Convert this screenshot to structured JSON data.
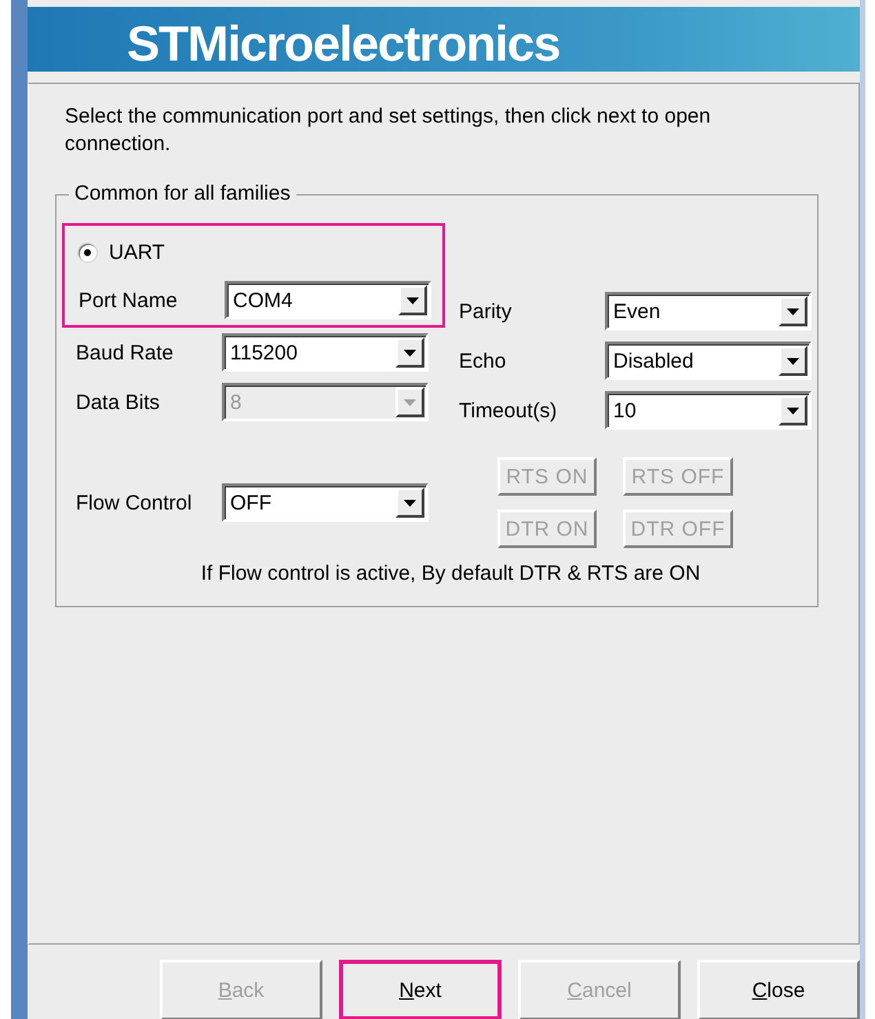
{
  "banner": {
    "title": "STMicroelectronics"
  },
  "instruction": "Select the communication port and set settings, then click next to open connection.",
  "group": {
    "title": "Common for all families",
    "interface": {
      "label": "UART",
      "selected": true,
      "highlighted": true
    },
    "left_fields": [
      {
        "label": "Port Name",
        "value": "COM4",
        "disabled": false
      },
      {
        "label": "Baud Rate",
        "value": "115200",
        "disabled": false
      },
      {
        "label": "Data Bits",
        "value": "8",
        "disabled": true
      }
    ],
    "right_fields": [
      {
        "label": "Parity",
        "value": "Even",
        "disabled": false
      },
      {
        "label": "Echo",
        "value": "Disabled",
        "disabled": false
      },
      {
        "label": "Timeout(s)",
        "value": "10",
        "disabled": false
      }
    ],
    "flow_control": {
      "label": "Flow Control",
      "value": "OFF",
      "disabled": false
    },
    "line_buttons": [
      {
        "label": "RTS ON",
        "disabled": true
      },
      {
        "label": "RTS OFF",
        "disabled": true
      },
      {
        "label": "DTR ON",
        "disabled": true
      },
      {
        "label": "DTR OFF",
        "disabled": true
      }
    ],
    "note": "If Flow control is active, By default DTR & RTS are ON"
  },
  "buttons": [
    {
      "label": "Back",
      "disabled": true,
      "highlighted": false
    },
    {
      "label": "Next",
      "disabled": false,
      "highlighted": true
    },
    {
      "label": "Cancel",
      "disabled": true,
      "highlighted": false
    },
    {
      "label": "Close",
      "disabled": false,
      "highlighted": false
    }
  ]
}
